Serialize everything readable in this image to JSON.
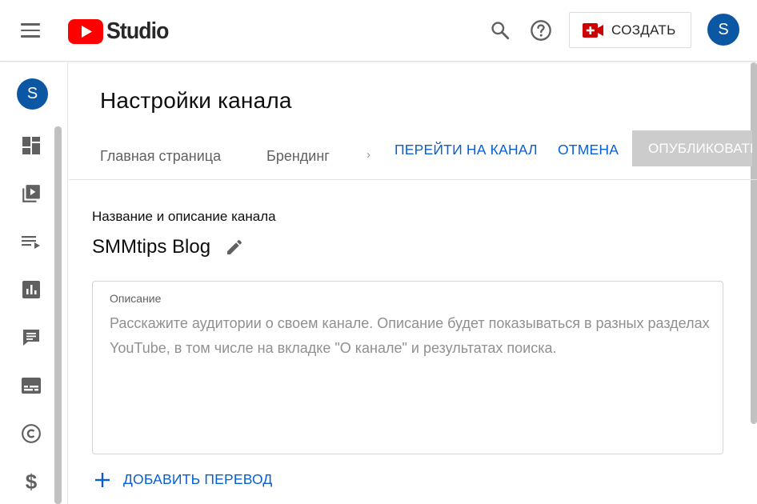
{
  "app": {
    "logo_text": "Studio",
    "brand_red": "#ff0000",
    "accent_blue": "#065fd4",
    "avatar_color": "#0b57a3"
  },
  "header": {
    "menu_icon": "hamburger-icon",
    "search_icon": "search-icon",
    "help_icon": "help-icon",
    "create_label": "СОЗДАТЬ",
    "create_icon": "video-camera-plus-icon",
    "avatar_letter": "S"
  },
  "sidebar": {
    "avatar_letter": "S",
    "items": [
      {
        "icon": "dashboard-icon"
      },
      {
        "icon": "content-icon"
      },
      {
        "icon": "playlists-icon"
      },
      {
        "icon": "analytics-icon"
      },
      {
        "icon": "comments-icon"
      },
      {
        "icon": "subtitles-icon"
      },
      {
        "icon": "copyright-icon"
      },
      {
        "icon": "monetization-icon"
      }
    ]
  },
  "main": {
    "title": "Настройки канала",
    "tabs": [
      {
        "label": "Главная страница"
      },
      {
        "label": "Брендинг"
      }
    ],
    "tab_more": "›",
    "go_to_channel": "ПЕРЕЙТИ НА КАНАЛ",
    "cancel": "ОТМЕНА",
    "publish": "ОПУБЛИКОВАТЬ",
    "section_title": "Название и описание канала",
    "channel_name": "SMMtips Blog",
    "description": {
      "label": "Описание",
      "placeholder": "Расскажите аудитории о своем канале. Описание будет показываться в разных разделах YouTube, в том числе на вкладке \"О канале\" и результатах поиска."
    },
    "add_translation": "ДОБАВИТЬ ПЕРЕВОД"
  }
}
